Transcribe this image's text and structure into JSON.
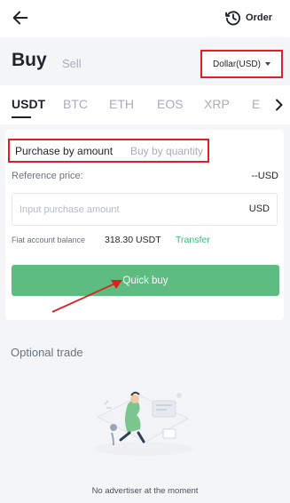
{
  "header": {
    "order_label": "Order"
  },
  "trade_mode": {
    "buy_label": "Buy",
    "sell_label": "Sell"
  },
  "currency": {
    "selected": "Dollar(USD)"
  },
  "coin_tabs": [
    "USDT",
    "BTC",
    "ETH",
    "EOS",
    "XRP",
    "E"
  ],
  "active_tab": "USDT",
  "purchase_method": {
    "by_amount_label": "Purchase by amount",
    "by_quantity_label": "Buy by quantity",
    "selected": "Purchase by amount"
  },
  "reference_price": {
    "label": "Reference price:",
    "value": "--USD"
  },
  "amount_input": {
    "placeholder": "Input purchase amount",
    "value": "",
    "unit": "USD"
  },
  "balance": {
    "label": "Fiat account balance",
    "value": "318.30 USDT",
    "transfer_label": "Transfer"
  },
  "quick_buy": {
    "label": "Quick buy"
  },
  "optional_trade": {
    "title": "Optional trade",
    "empty_message": "No advertiser at the moment"
  },
  "colors": {
    "highlight_box": "#e02020",
    "primary_green": "#5dbd80",
    "link_green": "#3cb878",
    "text_dark": "#1f2329",
    "text_muted": "#a7aeb8",
    "background": "#f4f5f7"
  },
  "icons": {
    "back": "arrow-left-icon",
    "order": "history-clock-icon",
    "currency_caret": "caret-down-icon",
    "tabs_more": "chevron-right-icon",
    "empty_state": "empty-illustration"
  }
}
